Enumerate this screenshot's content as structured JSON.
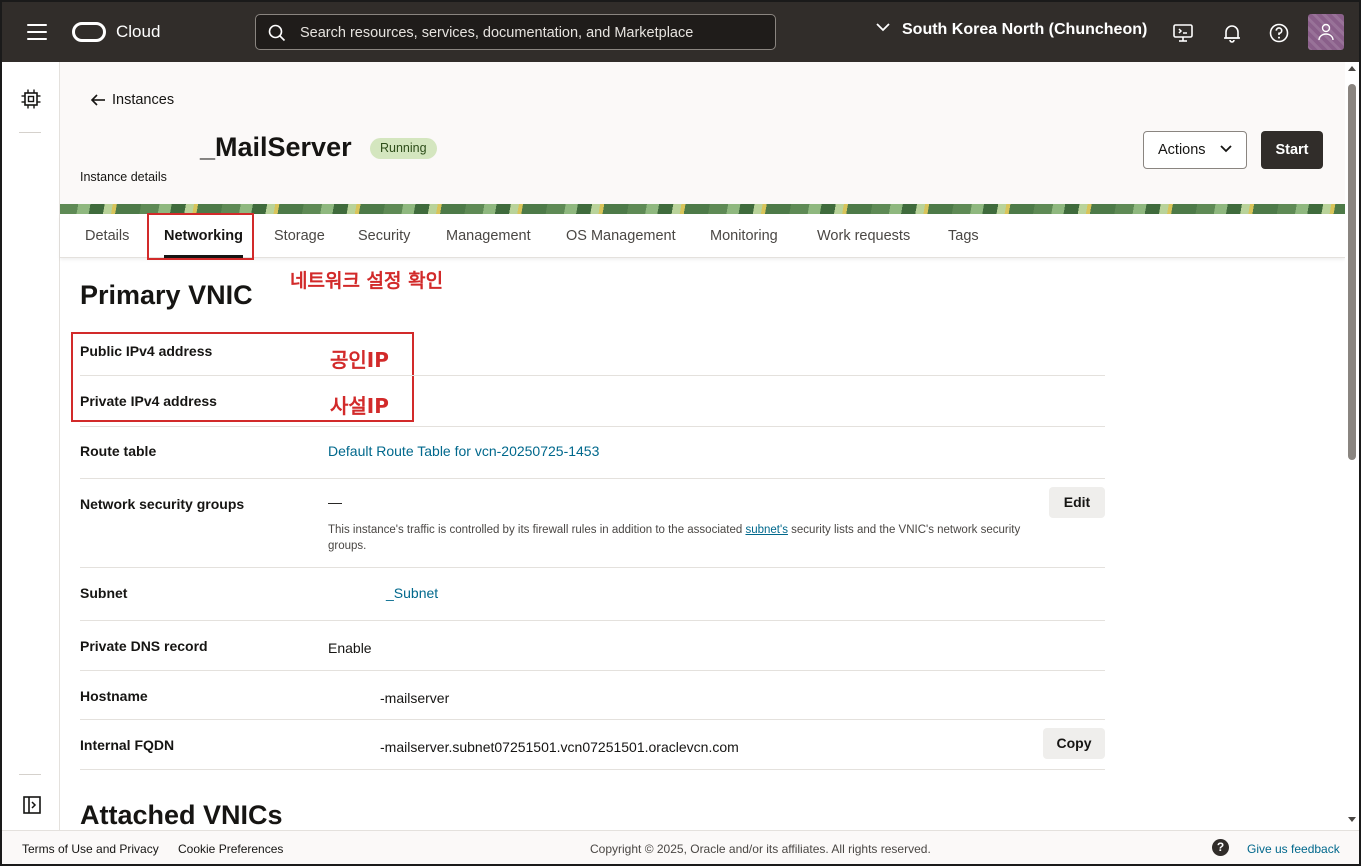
{
  "topbar": {
    "brand": "Cloud",
    "search_placeholder": "Search resources, services, documentation, and Marketplace",
    "region": "South Korea North (Chuncheon)"
  },
  "header": {
    "back_label": "Instances",
    "title": "_MailServer",
    "status": "Running",
    "subtitle": "Instance details",
    "actions_label": "Actions",
    "start_label": "Start"
  },
  "tabs": [
    {
      "label": "Details"
    },
    {
      "label": "Networking"
    },
    {
      "label": "Storage"
    },
    {
      "label": "Security"
    },
    {
      "label": "Management"
    },
    {
      "label": "OS Management"
    },
    {
      "label": "Monitoring"
    },
    {
      "label": "Work requests"
    },
    {
      "label": "Tags"
    }
  ],
  "annotations": {
    "network_check": "네트워크 설정 확인",
    "public_ip": "공인IP",
    "private_ip": "사설IP"
  },
  "section": {
    "primary_vnic": "Primary VNIC",
    "attached_vnics": "Attached VNICs"
  },
  "rows": {
    "public_ip_label": "Public IPv4 address",
    "private_ip_label": "Private IPv4 address",
    "route_table_label": "Route table",
    "route_table_value": "Default Route Table for vcn-20250725-1453",
    "nsg_label": "Network security groups",
    "nsg_value": "—",
    "nsg_edit": "Edit",
    "nsg_note_a": "This instance's traffic is controlled by its firewall rules in addition to the associated ",
    "nsg_note_link": "subnet's",
    "nsg_note_b": " security lists and the VNIC's network security groups.",
    "subnet_label": "Subnet",
    "subnet_value": "_Subnet",
    "dns_label": "Private DNS record",
    "dns_value": "Enable",
    "hostname_label": "Hostname",
    "hostname_value": "-mailserver",
    "fqdn_label": "Internal FQDN",
    "fqdn_value": "-mailserver.subnet07251501.vcn07251501.oraclevcn.com",
    "fqdn_copy": "Copy"
  },
  "footer": {
    "terms": "Terms of Use and Privacy",
    "cookies": "Cookie Preferences",
    "copyright": "Copyright © 2025, Oracle and/or its affiliates. All rights reserved.",
    "help": "?",
    "feedback": "Give us feedback"
  },
  "colors": {
    "topbar": "#312d2a",
    "status_badge": "#d4e6bf",
    "annotation_red": "#d22a2a",
    "link": "#00688c"
  }
}
